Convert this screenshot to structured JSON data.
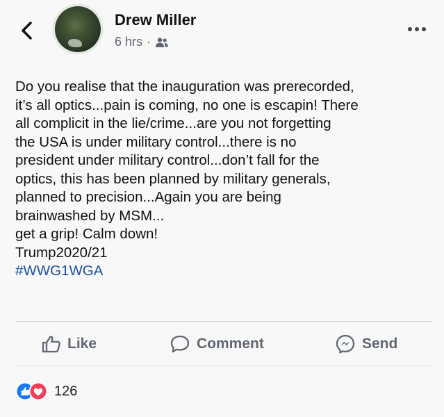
{
  "header": {
    "author_name": "Drew Miller",
    "time_ago": "6 hrs",
    "separator": "·",
    "icons": {
      "back": "chevron-left-icon",
      "audience": "friends-icon",
      "more": "more-options-icon"
    }
  },
  "post": {
    "lines": [
      "Do you realise that the inauguration was prerecorded,",
      "it’s all optics...pain is coming, no one is escapin! There",
      "all complicit in the lie/crime...are you not forgetting",
      "the USA is under military control...there is no",
      "president under military control...don’t fall for the",
      "optics, this has been planned by military generals,",
      "planned to precision...Again you are being",
      "brainwashed by MSM...",
      "get a grip! Calm down!",
      "Trump2020/21"
    ],
    "hashtag": "#WWG1WGA"
  },
  "actions": {
    "like_label": "Like",
    "comment_label": "Comment",
    "send_label": "Send"
  },
  "reactions": {
    "count": "126",
    "colors": {
      "like": "#1877f2",
      "love": "#f33e58"
    }
  }
}
